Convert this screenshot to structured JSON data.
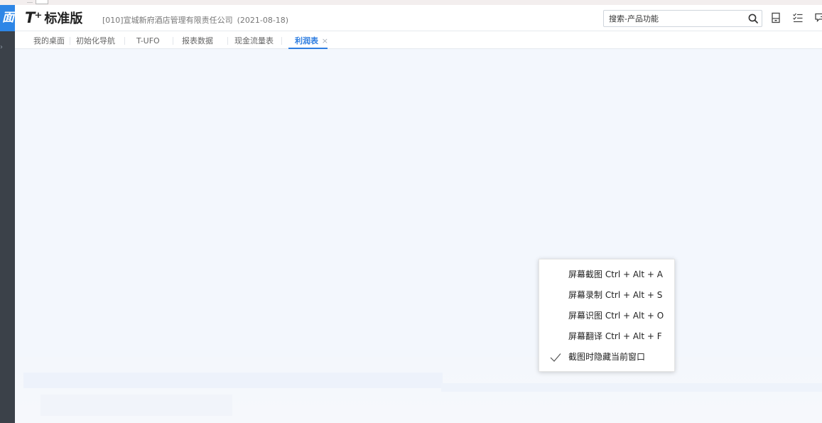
{
  "brand": {
    "prefix": "T⁺",
    "name": "标准版"
  },
  "header": {
    "company": "[010]宣城新府酒店管理有限责任公司",
    "date": "(2021-08-18)",
    "search_placeholder": "搜索-产品功能",
    "icons": [
      "search-icon",
      "calculator-icon",
      "task-list-icon",
      "message-icon"
    ]
  },
  "sidebar": {
    "logo_char": "面"
  },
  "tabs": [
    {
      "label": "我的桌面"
    },
    {
      "label": "初始化导航"
    },
    {
      "label": "T-UFO"
    },
    {
      "label": "报表数据"
    },
    {
      "label": "现金流量表"
    },
    {
      "label": "利润表",
      "active": true,
      "close": "×"
    }
  ],
  "context_menu": {
    "items": [
      {
        "label": "屏幕截图 Ctrl + Alt + A",
        "checked": false
      },
      {
        "label": "屏幕录制 Ctrl + Alt + S",
        "checked": false
      },
      {
        "label": "屏幕识图 Ctrl + Alt + O",
        "checked": false
      },
      {
        "label": "屏幕翻译 Ctrl + Alt + F",
        "checked": false
      },
      {
        "label": "截图时隐藏当前窗口",
        "checked": true
      }
    ]
  },
  "colors": {
    "accent": "#2e7de0",
    "sidebar": "#3b4149",
    "logo_bg": "#2e86e6",
    "content_bg": "#f3f7fd"
  }
}
